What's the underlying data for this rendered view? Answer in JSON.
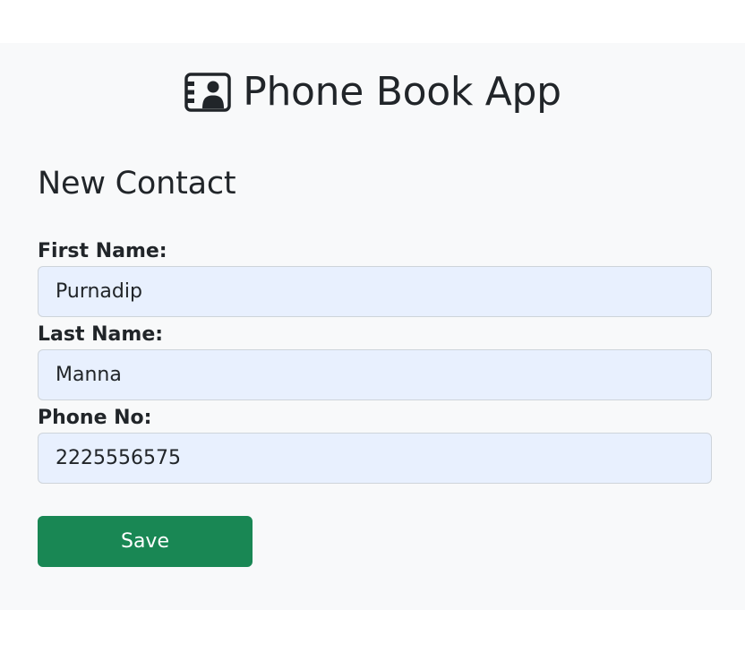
{
  "header": {
    "icon": "contact-card-icon",
    "title": "Phone Book App"
  },
  "form": {
    "heading": "New Contact",
    "fields": [
      {
        "label": "First Name:",
        "value": "Purnadip"
      },
      {
        "label": "Last Name:",
        "value": "Manna"
      },
      {
        "label": "Phone No:",
        "value": "2225556575"
      }
    ],
    "save_label": "Save"
  },
  "colors": {
    "panel_background": "#f8f9fa",
    "input_autofill_background": "#e8f0fe",
    "save_button": "#198754",
    "text": "#212529"
  }
}
